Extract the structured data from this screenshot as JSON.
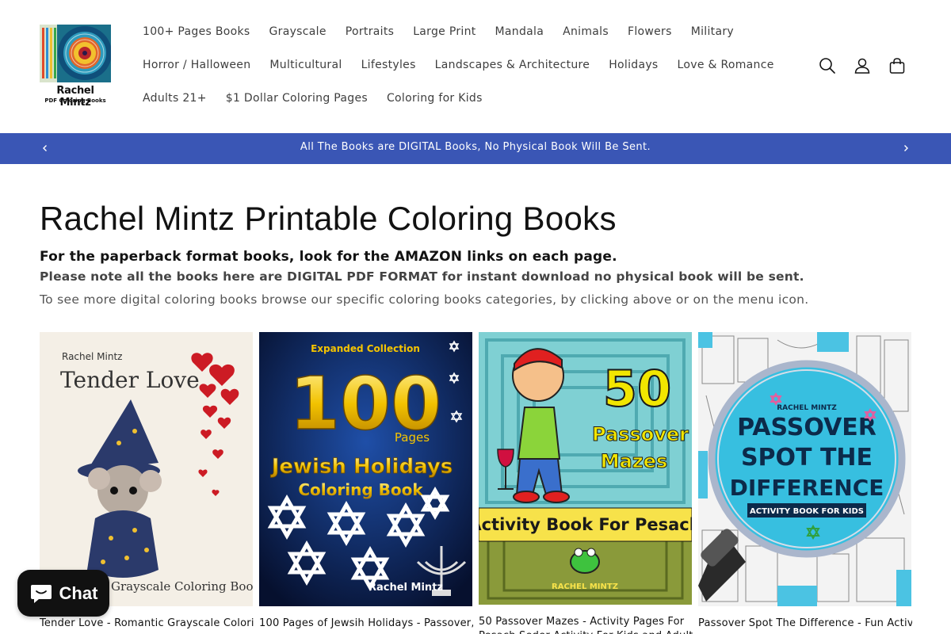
{
  "logo": {
    "line1": "Rachel Mintz",
    "line2": "PDF Coloring Books"
  },
  "nav": {
    "row1": [
      "100+ Pages Books",
      "Grayscale",
      "Portraits",
      "Large Print",
      "Mandala",
      "Animals",
      "Flowers",
      "Military"
    ],
    "row2": [
      "Horror / Halloween",
      "Multicultural",
      "Lifestyles",
      "Landscapes & Architecture",
      "Holidays",
      "Love & Romance"
    ],
    "row3": [
      "Adults 21+",
      "$1 Dollar Coloring Pages",
      "Coloring for Kids"
    ]
  },
  "header_icons": [
    "search-icon",
    "account-icon",
    "cart-icon"
  ],
  "announcement": {
    "text": "All The Books are DIGITAL Books, No Physical Book Will Be Sent."
  },
  "main": {
    "title": "Rachel Mintz Printable Coloring Books",
    "lead1": "For the paperback format books, look for the AMAZON links on each page.",
    "lead2": "Please note all the books here are DIGITAL PDF FORMAT for instant download no physical book will be sent.",
    "lead3": "To see more digital coloring books browse our specific coloring books categories, by clicking above or on the menu icon."
  },
  "products": [
    {
      "title": "Tender Love - Romantic Grayscale Coloring",
      "cover": {
        "author": "Rachel Mintz",
        "heading": "Tender Love",
        "footer": "Grayscale Coloring Book"
      }
    },
    {
      "title": "100 Pages of Jewsih Holidays - Passover,",
      "cover": {
        "top": "Expanded Collection",
        "big": "100",
        "pages": "Pages",
        "line1": "Jewish Holidays",
        "line2": "Coloring Book",
        "author": "Rachel Mintz"
      }
    },
    {
      "title": "50 Passover Mazes - Activity Pages For",
      "title2": "Pesach Seder Activity For Kids and Adult",
      "cover": {
        "big": "50",
        "line1": "Passover",
        "line2": "Mazes",
        "banner": "Activity Book For Pesach",
        "author": "RACHEL MINTZ"
      }
    },
    {
      "title": "Passover Spot The Difference - Fun Activity",
      "cover": {
        "author": "RACHEL MINTZ",
        "line1": "PASSOVER",
        "line2": "SPOT THE",
        "line3": "DIFFERENCE",
        "sub": "ACTIVITY BOOK FOR KIDS"
      }
    }
  ],
  "chat": {
    "label": "Chat"
  },
  "colors": {
    "announcement_bg": "#3a56b5",
    "chat_bg": "#111111"
  }
}
